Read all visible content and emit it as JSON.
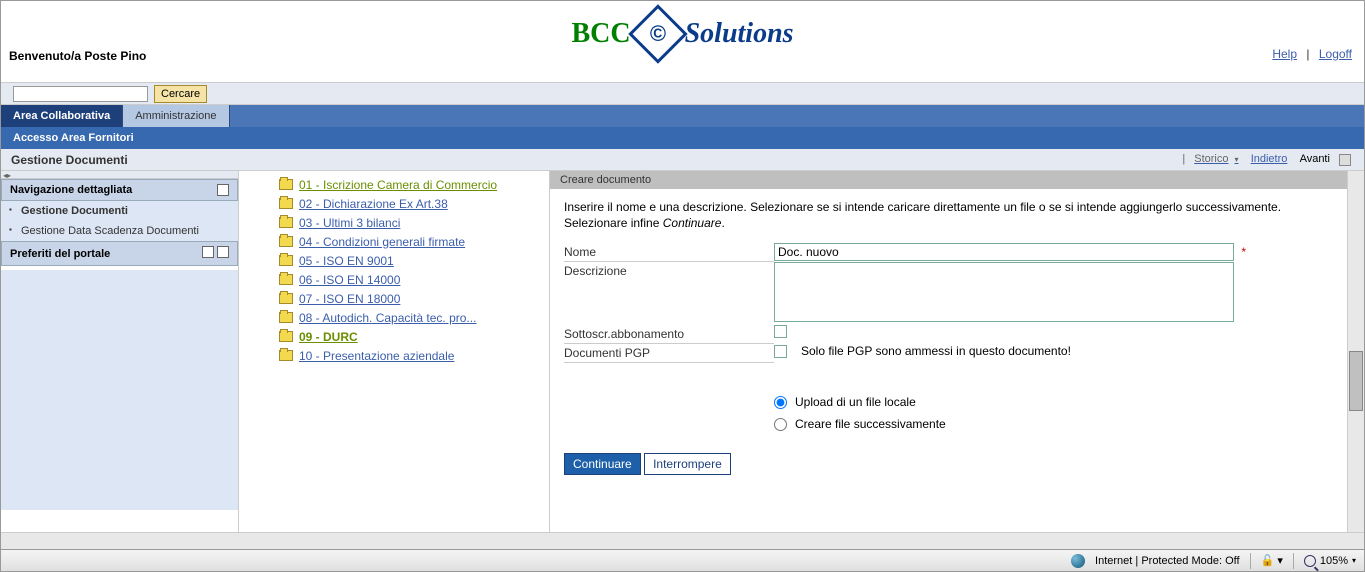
{
  "header": {
    "welcome": "Benvenuto/a Poste Pino",
    "logo_brand": "BCC",
    "logo_suffix": "Solutions",
    "help": "Help",
    "logoff": "Logoff"
  },
  "search": {
    "value": "",
    "button": "Cercare"
  },
  "tabs": {
    "collab": "Area Collaborativa",
    "admin": "Amministrazione"
  },
  "subheader": "Accesso Area Fornitori",
  "breadcrumb": {
    "title": "Gestione Documenti",
    "storico": "Storico",
    "indietro": "Indietro",
    "avanti": "Avanti"
  },
  "sidebar": {
    "nav_head": "Navigazione dettagliata",
    "items": [
      {
        "label": "Gestione Documenti",
        "active": true
      },
      {
        "label": "Gestione Data Scadenza Documenti",
        "active": false
      }
    ],
    "fav_head": "Preferiti del portale"
  },
  "folders": [
    {
      "label": "01 - Iscrizione Camera di Commercio"
    },
    {
      "label": "02 - Dichiarazione Ex Art.38"
    },
    {
      "label": "03 - Ultimi 3 bilanci"
    },
    {
      "label": "04 - Condizioni generali firmate"
    },
    {
      "label": "05 - ISO EN 9001"
    },
    {
      "label": "06 - ISO EN 14000"
    },
    {
      "label": "07 - ISO EN 18000"
    },
    {
      "label": "08 - Autodich. Capacità tec. pro..."
    },
    {
      "label": "09 - DURC",
      "selected": true
    },
    {
      "label": "10 - Presentazione aziendale"
    }
  ],
  "form": {
    "heading": "Creare documento",
    "instr1": "Inserire il nome e una descrizione. Selezionare se si intende caricare direttamente un file o se si intende aggiungerlo successivamente. Selezionare infine ",
    "instr_em": "Continuare",
    "name_label": "Nome",
    "name_value": "Doc. nuovo",
    "desc_label": "Descrizione",
    "desc_value": "",
    "sub_label": "Sottoscr.abbonamento",
    "pgp_label": "Documenti PGP",
    "pgp_hint": "Solo file PGP sono ammessi in questo documento!",
    "radio_upload": "Upload di un file locale",
    "radio_later": "Creare file successivamente",
    "btn_continue": "Continuare",
    "btn_cancel": "Interrompere"
  },
  "status": {
    "mode": "Internet | Protected Mode: Off",
    "zoom": "105%"
  }
}
